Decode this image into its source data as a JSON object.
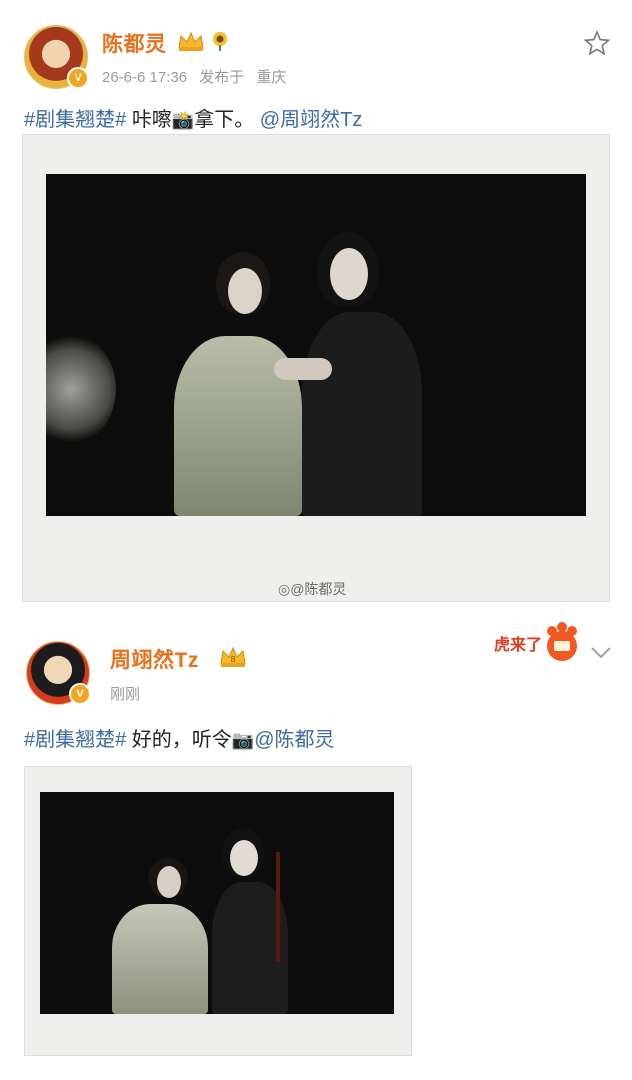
{
  "posts": [
    {
      "author": "陈都灵",
      "timestamp": "26-6-6 17:36",
      "location_prefix": "发布于",
      "location": "重庆",
      "hashtag": "#剧集翘楚#",
      "text_before_icon": "咔嚓",
      "text_after_icon": "拿下。",
      "mention": "@周翊然Tz",
      "watermark": "@陈都灵"
    },
    {
      "author": "周翊然Tz",
      "timestamp": "刚刚",
      "hashtag": "#剧集翘楚#",
      "text_before_icon": "好的，听令",
      "mention": "@陈都灵",
      "sticker_text": "虎来了"
    }
  ],
  "icons": [
    "avatar",
    "verified-badge-icon",
    "crown-icon",
    "sunflower-icon",
    "star-icon",
    "camera-icon",
    "chevron-down-icon",
    "weibo-logo-icon"
  ],
  "colors": {
    "author": "#e8711b",
    "link": "#3d6aa3",
    "meta": "#9a9a9a",
    "text": "#222222"
  }
}
